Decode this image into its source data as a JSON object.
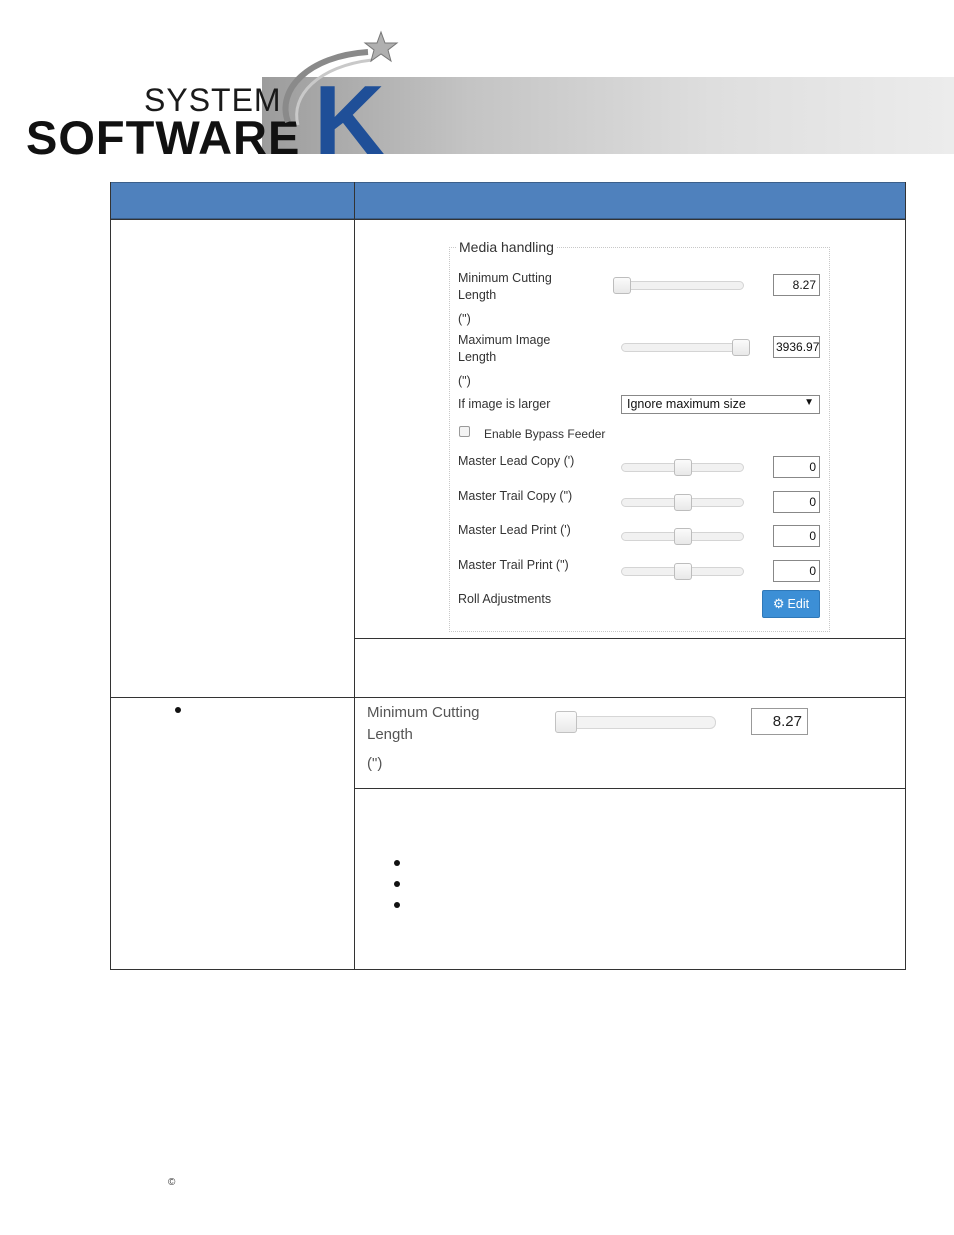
{
  "logo": {
    "line1": "SYSTEM",
    "line2": "SOFTWARE",
    "mark": "K",
    "icons": [
      "star-swoosh-icon"
    ]
  },
  "media_handling": {
    "legend": "Media handling",
    "min_cutting": {
      "label": "Minimum Cutting Length",
      "unit": "(\")",
      "value": "8.27",
      "level": 0.0
    },
    "max_image": {
      "label": "Maximum Image Length",
      "unit": "(\")",
      "value": "3936.97",
      "level": 1.0
    },
    "if_larger": {
      "label": "If image is larger",
      "selected": "Ignore maximum size"
    },
    "bypass": {
      "label": "Enable Bypass Feeder",
      "checked": false
    },
    "rows": [
      {
        "label": "Master Lead Copy (')",
        "value": "0",
        "level": 0.5
      },
      {
        "label": "Master Trail Copy (\")",
        "value": "0",
        "level": 0.5
      },
      {
        "label": "Master Lead Print (')",
        "value": "0",
        "level": 0.5
      },
      {
        "label": "Master Trail Print (\")",
        "value": "0",
        "level": 0.5
      }
    ],
    "roll": {
      "label": "Roll Adjustments",
      "button": "Edit"
    }
  },
  "zoomed": {
    "label_line1": "Minimum Cutting",
    "label_line2": "Length",
    "unit": "(\")",
    "value": "8.27",
    "level": 0.0
  },
  "footer": {
    "copyright": "©"
  },
  "colors": {
    "header": "#4f81bd",
    "button": "#3c8fd6"
  }
}
